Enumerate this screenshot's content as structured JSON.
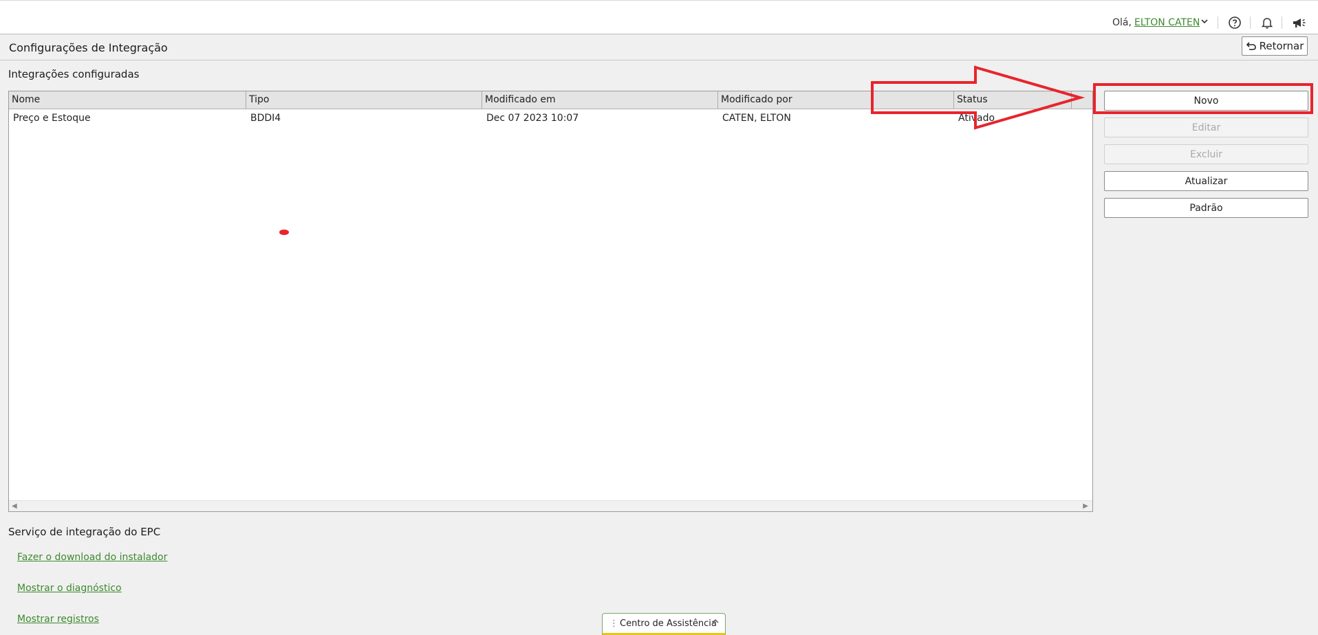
{
  "header": {
    "greeting": "Olá,",
    "username": "ELTON CATEN",
    "icons": [
      "chevron-down-icon",
      "help-icon",
      "bell-icon",
      "megaphone-icon"
    ]
  },
  "titlebar": {
    "title": "Configurações de Integração",
    "back_label": "Retornar"
  },
  "integrations": {
    "section_title": "Integrações configuradas",
    "columns": [
      "Nome",
      "Tipo",
      "Modificado em",
      "Modificado por",
      "Status"
    ],
    "rows": [
      [
        "Preço e Estoque",
        "BDDI4",
        "Dec 07 2023 10:07",
        "CATEN, ELTON",
        "Ativado"
      ]
    ]
  },
  "actions": {
    "new": "Novo",
    "edit": "Editar",
    "delete": "Excluir",
    "refresh": "Atualizar",
    "default": "Padrão"
  },
  "epc": {
    "section_title": "Serviço de integração do EPC",
    "links": [
      "Fazer o download do instalador",
      "Mostrar o diagnóstico",
      "Mostrar registros"
    ]
  },
  "help_center": {
    "label": "Centro de Assistência"
  },
  "colors": {
    "accent_green": "#3c8a2e",
    "annotation_red": "#e8242c"
  }
}
